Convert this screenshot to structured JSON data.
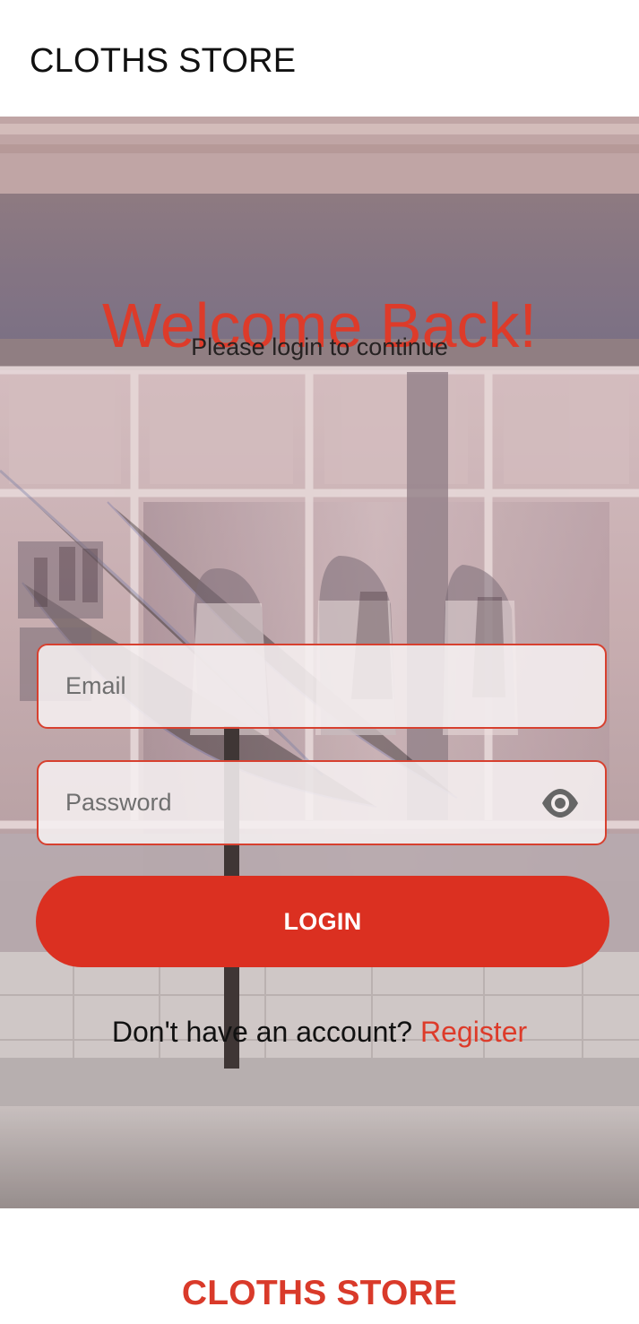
{
  "header": {
    "title": "CLOTHS STORE"
  },
  "hero": {
    "background_image": "clothing-store-storefront",
    "welcome_title": "Welcome Back!",
    "subtitle": "Please login to continue"
  },
  "form": {
    "email": {
      "value": "",
      "placeholder": "Email"
    },
    "password": {
      "value": "",
      "placeholder": "Password",
      "icon": "eye-icon"
    },
    "login_label": "LOGIN",
    "register_prompt": "Don't have an account? ",
    "register_label": "Register"
  },
  "footer": {
    "title": "CLOTHS STORE"
  },
  "colors": {
    "accent": "#DB3021",
    "accent_text": "#DD3B2A",
    "field_border": "#D7402F",
    "background": "#FFFFFF"
  }
}
